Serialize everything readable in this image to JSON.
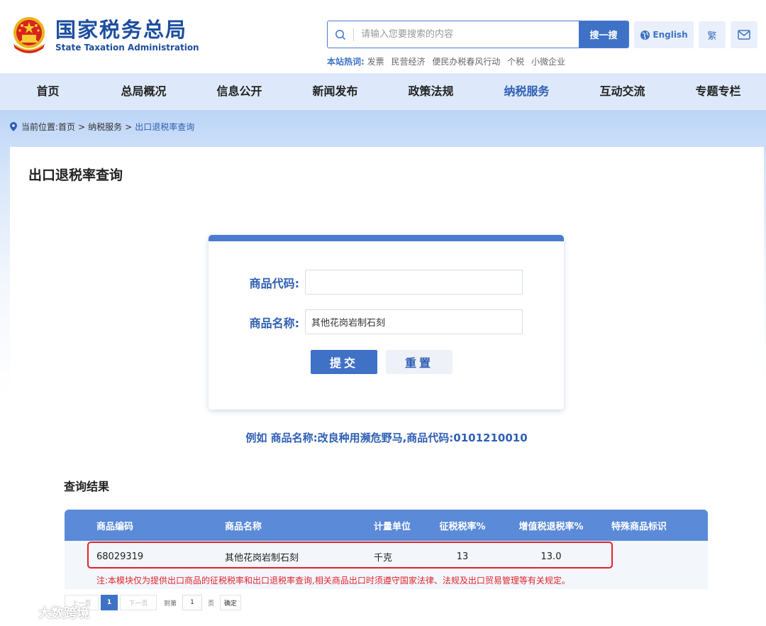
{
  "header": {
    "logo_cn": "国家税务总局",
    "logo_en": "State Taxation Administration",
    "search_placeholder": "请输入您要搜索的内容",
    "search_button": "搜一搜",
    "hot_label": "本站热词:",
    "hot_words": [
      "发票",
      "民营经济",
      "便民办税春风行动",
      "个税",
      "小微企业"
    ],
    "english_button": "English",
    "traditional_button": "繁"
  },
  "nav": {
    "items": [
      "首页",
      "总局概况",
      "信息公开",
      "新闻发布",
      "政策法规",
      "纳税服务",
      "互动交流",
      "专题专栏"
    ],
    "active_index": 5
  },
  "breadcrumb": {
    "prefix": "当前位置:",
    "home": "首页",
    "section": "纳税服务",
    "current": "出口退税率查询",
    "separator": ">"
  },
  "page_title": "出口退税率查询",
  "form": {
    "code_label": "商品代码:",
    "code_value": "",
    "name_label": "商品名称:",
    "name_value": "其他花岗岩制石刻",
    "submit_label": "提交",
    "reset_label": "重置"
  },
  "example_text": "例如 商品名称:改良种用濒危野马,商品代码:0101210010",
  "results": {
    "title": "查询结果",
    "columns": [
      "商品编码",
      "商品名称",
      "计量单位",
      "征税税率%",
      "增值税退税率%",
      "特殊商品标识"
    ],
    "rows": [
      {
        "code": "68029319",
        "name": "其他花岗岩制石刻",
        "unit": "千克",
        "tax_rate": "13",
        "refund_rate": "13.0",
        "special": ""
      }
    ],
    "note": "注:本模块仅为提供出口商品的征税税率和出口退税率查询,相关商品出口时须遵守国家法律、法规及出口贸易管理等有关规定。"
  },
  "pagination": {
    "prev": "上一页",
    "current_page": "1",
    "next": "下一页",
    "goto_label": "到第",
    "goto_value": "1",
    "page_label": "页",
    "confirm": "确定"
  },
  "watermark": "大数跨境",
  "colors": {
    "brand_blue": "#3f72c6",
    "nav_bg": "#dde9fa",
    "highlight_red": "#e0242b",
    "table_header": "#5a8ad8"
  }
}
